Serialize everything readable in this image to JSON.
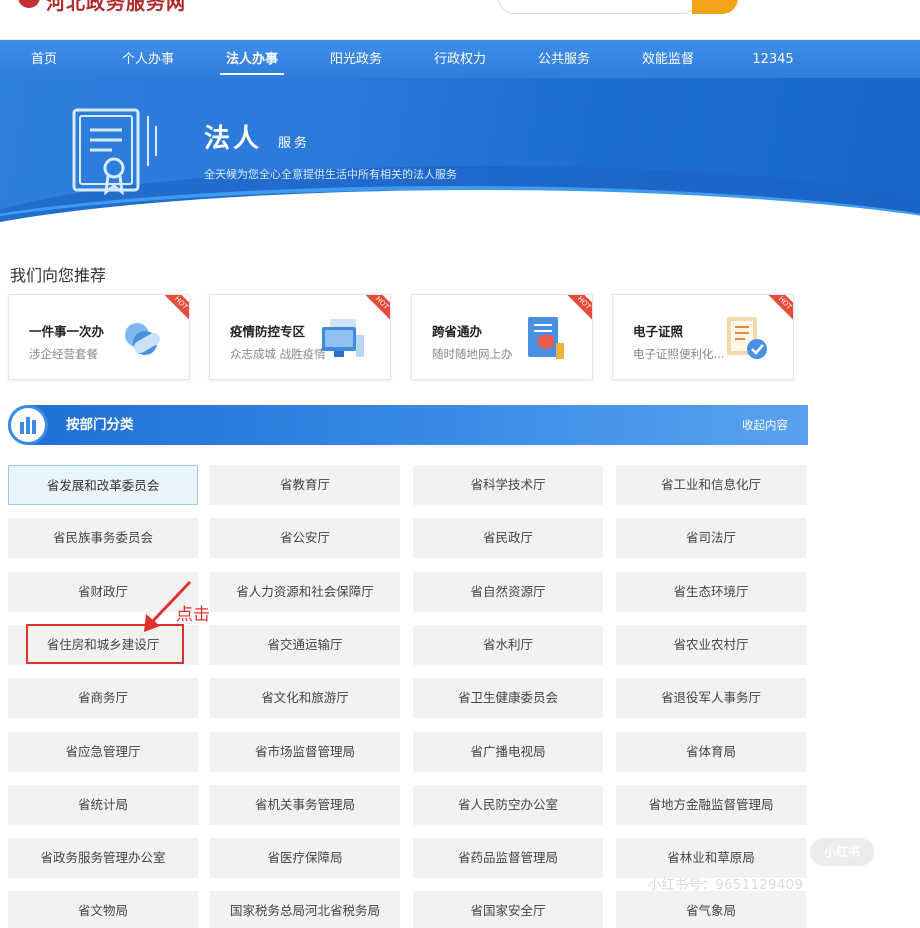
{
  "header": {
    "site_title": "河北政务服务网"
  },
  "nav": {
    "items": [
      {
        "label": "首页"
      },
      {
        "label": "个人办事"
      },
      {
        "label": "法人办事"
      },
      {
        "label": "阳光政务"
      },
      {
        "label": "行政权力"
      },
      {
        "label": "公共服务"
      },
      {
        "label": "效能监督"
      },
      {
        "label": "12345"
      }
    ],
    "active": "法人办事"
  },
  "banner": {
    "title": "法人",
    "title_small": "服务",
    "subtitle": "全天候为您全心全意提供生活中所有相关的法人服务"
  },
  "recommend": {
    "title": "我们向您推荐",
    "hot_badge": "HOT",
    "cards": [
      {
        "title": "一件事一次办",
        "subtitle": "涉企经营套餐",
        "icon": "pill-cloud-icon"
      },
      {
        "title": "疫情防控专区",
        "subtitle": "众志成城 战胜疫情",
        "icon": "monitor-icon"
      },
      {
        "title": "跨省通办",
        "subtitle": "随时随地网上办",
        "icon": "document-shield-icon"
      },
      {
        "title": "电子证照",
        "subtitle": "电子证照便利化...",
        "icon": "certificate-check-icon"
      }
    ]
  },
  "department": {
    "title": "按部门分类",
    "collapse": "收起内容",
    "items": [
      "省发展和改革委员会",
      "省教育厅",
      "省科学技术厅",
      "省工业和信息化厅",
      "省民族事务委员会",
      "省公安厅",
      "省民政厅",
      "省司法厅",
      "省财政厅",
      "省人力资源和社会保障厅",
      "省自然资源厅",
      "省生态环境厅",
      "省住房和城乡建设厅",
      "省交通运输厅",
      "省水利厅",
      "省农业农村厅",
      "省商务厅",
      "省文化和旅游厅",
      "省卫生健康委员会",
      "省退役军人事务厅",
      "省应急管理厅",
      "省市场监督管理局",
      "省广播电视局",
      "省体育局",
      "省统计局",
      "省机关事务管理局",
      "省人民防空办公室",
      "省地方金融监督管理局",
      "省政务服务管理办公室",
      "省医疗保障局",
      "省药品监督管理局",
      "省林业和草原局",
      "省文物局",
      "国家税务总局河北省税务局",
      "省国家安全厅",
      "省气象局"
    ],
    "selected": "省发展和改革委员会"
  },
  "annotation": {
    "text": "点击",
    "target": "省住房和城乡建设厅",
    "color": "#e0312d"
  },
  "watermark": {
    "brand": "小红书",
    "id": "小红书号：9651129409"
  }
}
